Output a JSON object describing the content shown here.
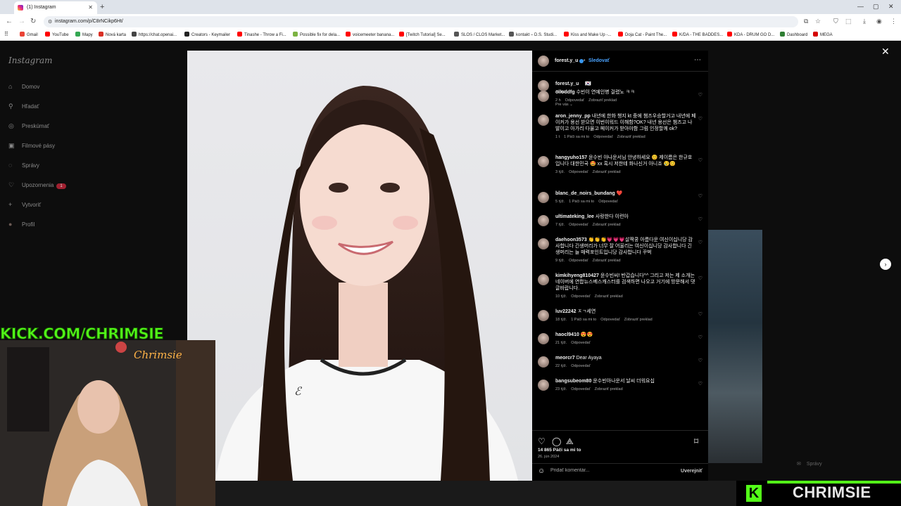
{
  "browser": {
    "tab_title": "(1) Instagram",
    "url": "instagram.com/p/C8rNCikp6Ht/",
    "bookmarks": [
      {
        "label": "Gmail",
        "color": "#ea4335"
      },
      {
        "label": "YouTube",
        "color": "#ff0000"
      },
      {
        "label": "Mapy",
        "color": "#34a853"
      },
      {
        "label": "Nová karta",
        "color": "#d93025"
      },
      {
        "label": "https://chat.openai...",
        "color": "#444444"
      },
      {
        "label": "Creators - Keymailer",
        "color": "#222222"
      },
      {
        "label": "Tinashe - Throw a Fi...",
        "color": "#ff0000"
      },
      {
        "label": "Possible fix for dela...",
        "color": "#7cb342"
      },
      {
        "label": "voicemeeter banana...",
        "color": "#ff0000"
      },
      {
        "label": "[Twitch Tutorial] Se...",
        "color": "#ff0000"
      },
      {
        "label": "SLOS / CLOS Market...",
        "color": "#555555"
      },
      {
        "label": "kontakt – D.S. Studi...",
        "color": "#555555"
      },
      {
        "label": "Kiss and Make Up -...",
        "color": "#ff0000"
      },
      {
        "label": "Doja Cat - Paint The...",
        "color": "#ff0000"
      },
      {
        "label": "K/DA - THE BADDES...",
        "color": "#ff0000"
      },
      {
        "label": "KDA - DRUM GO D...",
        "color": "#ff0000"
      },
      {
        "label": "Dashboard",
        "color": "#2e7d32"
      },
      {
        "label": "MEGA",
        "color": "#d50000"
      }
    ]
  },
  "sidebar": {
    "logo": "Instagram",
    "items": [
      {
        "label": "Domov",
        "icon": "home-icon",
        "glyph": "⌂"
      },
      {
        "label": "Hľadať",
        "icon": "search-icon",
        "glyph": "⚲"
      },
      {
        "label": "Preskúmať",
        "icon": "compass-icon",
        "glyph": "◎"
      },
      {
        "label": "Filmové pásy",
        "icon": "reels-icon",
        "glyph": "▣"
      },
      {
        "label": "Správy",
        "icon": "messenger-icon",
        "glyph": "◌"
      },
      {
        "label": "Upozornenia",
        "icon": "heart-icon",
        "glyph": "♡",
        "badge": "1"
      },
      {
        "label": "Vytvoriť",
        "icon": "plus-icon",
        "glyph": "+"
      },
      {
        "label": "Profil",
        "icon": "avatar",
        "glyph": "●"
      }
    ]
  },
  "post": {
    "username": "forest.y_u",
    "follow_label": "Sledovať",
    "caption_time": "78 týž.",
    "sort_label": "Pre vás",
    "likes": "14 865 Páči sa mi to",
    "date": "26. jún 2024",
    "add_comment_placeholder": "Pridať komentár...",
    "post_label": "Uverejniť",
    "comments": [
      {
        "user": "oiloddfg",
        "text": "수빈이 연예인병 걸렸노 ㅋㅋ",
        "meta": [
          "2 h",
          "Odpovedať",
          "Zobraziť preklad"
        ]
      },
      {
        "user": "aron_jenny_pp",
        "text": "내년에 한화 챙지 kt 중에 챔즈우승할거고 내년에 페이커가 용선 받으면 이번이워드 이해함?OK? 내년 용선은 챔즈고 나발이고 아가리 다물고 페이커가 받아야함 그럼 인정할께 ok?",
        "meta": [
          "1 t",
          "1 Páči sa mi to",
          "Odpovedať",
          "Zobraziť preklad"
        ]
      },
      {
        "user": "hangyuho157",
        "text": "윤수빈 아나운서님 안녕하세요 😊 제이름은 한규호 입니다 대한민국 🤩 xx 혹시 저한테 화나신거 아니죠 😢😊",
        "meta": [
          "3 týž.",
          "Odpovedať",
          "Zobraziť preklad"
        ]
      },
      {
        "user": "blanc_de_noirs_bundang",
        "text": "❤️",
        "meta": [
          "5 týž.",
          "1 Páči sa mi to",
          "Odpovedať"
        ]
      },
      {
        "user": "ultimateking_lee",
        "text": "사랑한다 이련아",
        "meta": [
          "7 týž.",
          "Odpovedať",
          "Zobraziť preklad"
        ]
      },
      {
        "user": "daehoon3573",
        "text": "👏👏👏💗💗💗살짝쿵 아름다운 여신이십니당 감사합니다 긴생머리가 너무 잘 어울리는 여신이십니당 감사합니다 긴생머리는 늘 매력포인트입니당 감사합니다 꾸벅",
        "meta": [
          "9 týž.",
          "Odpovedať",
          "Zobraziť preklad"
        ]
      },
      {
        "user": "kimkihyeng810427",
        "text": "윤수빈씨! 반갑습니다^^ 그리고 저는 제 소개는 네이버에 연합뉴스베스캐스터를 검색하면 나오고 거기에 방문해서 댓글바랍니다.",
        "meta": [
          "10 týž.",
          "Odpovedať",
          "Zobraziť preklad"
        ]
      },
      {
        "user": "luv22242",
        "text": "ㅈㄱ세연",
        "meta": [
          "18 týž.",
          "1 Páči sa mi to",
          "Odpovedať",
          "Zobraziť preklad"
        ]
      },
      {
        "user": "haocl9410",
        "text": "😍😍",
        "meta": [
          "21 týž.",
          "Odpovedať"
        ]
      },
      {
        "user": "meorcr7",
        "text": "Dear Ayaya",
        "meta": [
          "22 týž.",
          "Odpovedať"
        ]
      },
      {
        "user": "bangsubeom80",
        "text": "윤수빈아나운서 날씨 더워요십",
        "meta": [
          "23 týž.",
          "Odpovedať",
          "Zobraziť preklad"
        ]
      }
    ]
  },
  "messages_bar": {
    "label": "Správy"
  },
  "overlay": {
    "kick_url": "KICK.COM/CHRIMSIE",
    "kick_name": "CHRIMSIE",
    "kick_letter": "K",
    "cam_sign": "Chrimsie",
    "kick_color": "#53fc18"
  }
}
